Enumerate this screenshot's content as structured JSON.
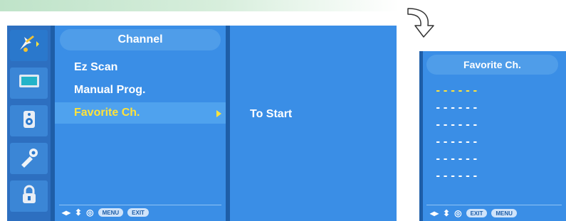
{
  "sidebar": {
    "items": [
      {
        "icon": "antenna-icon",
        "selected": true
      },
      {
        "icon": "picture-icon",
        "selected": false
      },
      {
        "icon": "audio-icon",
        "selected": false
      },
      {
        "icon": "option-icon",
        "selected": false
      },
      {
        "icon": "lock-icon",
        "selected": false
      }
    ]
  },
  "channel_menu": {
    "title": "Channel",
    "items": [
      {
        "label": "Ez Scan"
      },
      {
        "label": "Manual Prog."
      },
      {
        "label": "Favorite Ch.",
        "selected": true
      }
    ],
    "submenu_label": "To Start",
    "navbar": {
      "arrows_lr": "◂▸",
      "arrows_ud": "⬍",
      "ok": "◎",
      "menu": "MENU",
      "exit": "EXIT"
    }
  },
  "favorite_panel": {
    "title": "Favorite Ch.",
    "slots": [
      "------",
      "------",
      "------",
      "------",
      "------",
      "------"
    ],
    "active_slot": 0,
    "navbar": {
      "arrows_lr": "◂▸",
      "arrows_ud": "⬍",
      "ok": "◎",
      "exit": "EXIT",
      "menu": "MENU"
    }
  },
  "colors": {
    "osd_dark": "#1e5ea8",
    "panel": "#3a8ee6",
    "highlight_text": "#ffe33a"
  }
}
